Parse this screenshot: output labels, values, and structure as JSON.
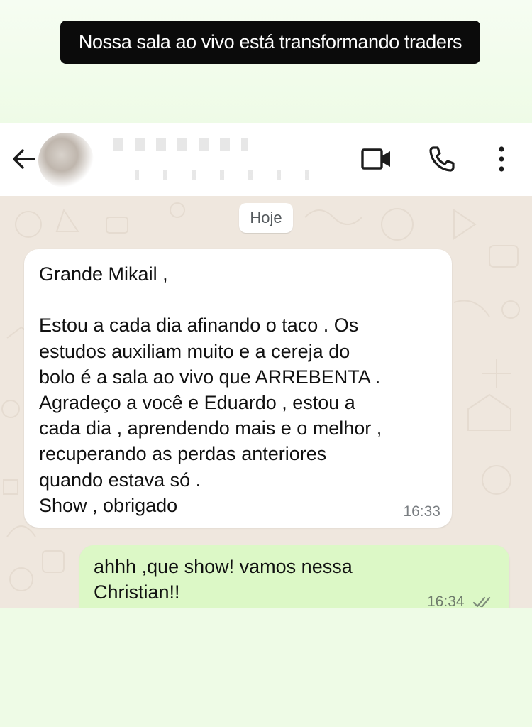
{
  "caption": "Nossa sala ao vivo está transformando traders",
  "header": {
    "contact_name": "",
    "contact_status": "",
    "back_icon": "arrow-left-icon",
    "video_icon": "video-call-icon",
    "call_icon": "phone-icon",
    "menu_icon": "more-vertical-icon"
  },
  "chat": {
    "date_label": "Hoje",
    "messages": [
      {
        "direction": "incoming",
        "text": "Grande Mikail ,\n\nEstou a cada dia afinando o taco . Os\nestudos auxiliam muito e a cereja do\nbolo é a sala ao vivo que ARREBENTA .\nAgradeço a você e Eduardo , estou a\ncada dia , aprendendo mais e o melhor ,\nrecuperando as perdas anteriores\nquando estava só .\nShow , obrigado",
        "time": "16:33"
      },
      {
        "direction": "outgoing",
        "text": "ahhh ,que show! vamos nessa\nChristian!!",
        "time": "16:34",
        "status_icon": "double-check-icon"
      }
    ]
  },
  "colors": {
    "background": "#eefbe6",
    "caption_bg": "#0b0b0b",
    "chat_wallpaper": "#efe7de",
    "incoming_bubble": "#ffffff",
    "outgoing_bubble": "#dcf8c6"
  }
}
